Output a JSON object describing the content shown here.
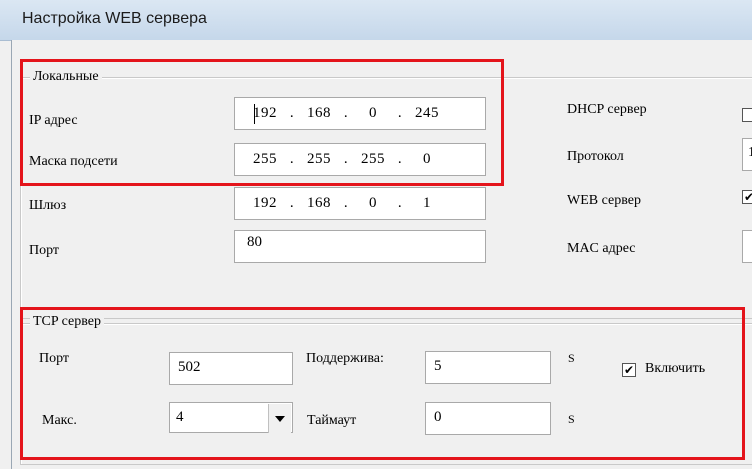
{
  "window": {
    "title": "Настройка WEB сервера"
  },
  "local": {
    "legend": "Локальные",
    "ip_label": "IP адрес",
    "ip": [
      "192",
      "168",
      "0",
      "245"
    ],
    "mask_label": "Маска подсети",
    "mask": [
      "255",
      "255",
      "255",
      "0"
    ],
    "gateway_label": "Шлюз",
    "gateway": [
      "192",
      "168",
      "0",
      "1"
    ],
    "port_label": "Порт",
    "port": "80",
    "dhcp_label": "DHCP сервер",
    "dhcp_checked": false,
    "protocol_label": "Протокол",
    "protocol_value": "1",
    "web_label": "WEB сервер",
    "web_checked": true,
    "mac_label": "MAC адрес",
    "checkmark": "✔"
  },
  "tcp": {
    "legend": "TCP сервер",
    "port_label": "Порт",
    "port": "502",
    "keepalive_label": "Поддержива:",
    "keepalive": "5",
    "keepalive_unit": "S",
    "enable_label": "Включить",
    "enable_checked": true,
    "max_label": "Макс.",
    "max_value": "4",
    "timeout_label": "Таймаут",
    "timeout": "0",
    "timeout_unit": "S",
    "checkmark": "✔"
  }
}
